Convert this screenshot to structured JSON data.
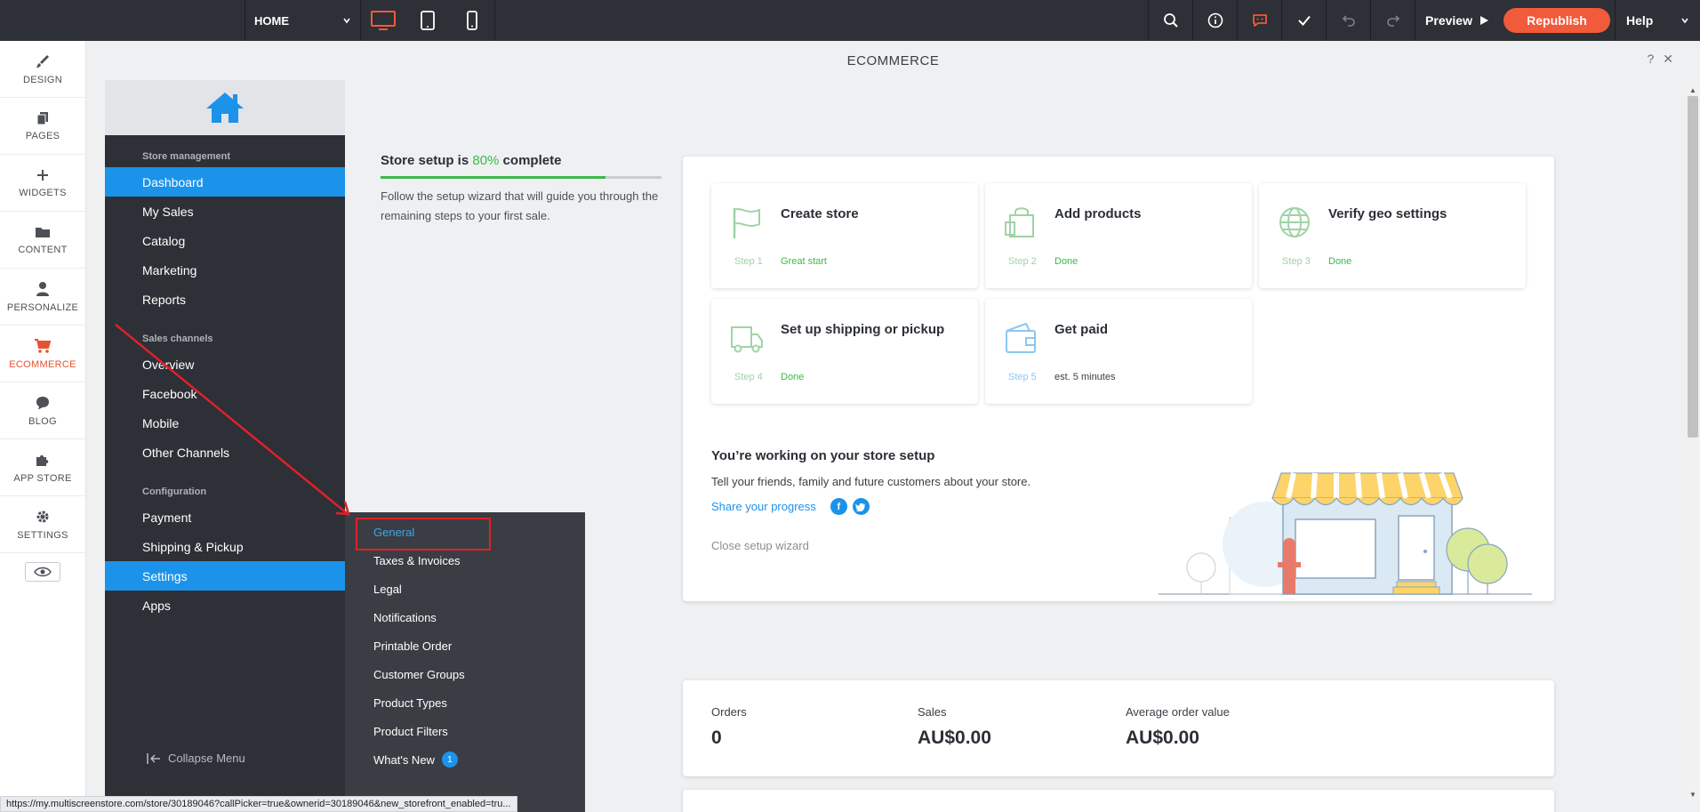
{
  "topbar": {
    "page_select": "HOME",
    "preview_label": "Preview",
    "republish_label": "Republish",
    "help_label": "Help",
    "accent": "#f15a3a"
  },
  "rail": {
    "items": [
      {
        "label": "DESIGN",
        "icon": "brush-icon"
      },
      {
        "label": "PAGES",
        "icon": "pages-icon"
      },
      {
        "label": "WIDGETS",
        "icon": "plus-icon"
      },
      {
        "label": "CONTENT",
        "icon": "folder-icon"
      },
      {
        "label": "PERSONALIZE",
        "icon": "person-icon"
      },
      {
        "label": "ECOMMERCE",
        "icon": "cart-icon"
      },
      {
        "label": "BLOG",
        "icon": "chat-bubble-icon"
      },
      {
        "label": "APP STORE",
        "icon": "puzzle-icon"
      },
      {
        "label": "SETTINGS",
        "icon": "gear-icon"
      }
    ]
  },
  "frame": {
    "title": "ECOMMERCE",
    "help_mark": "?",
    "close_mark": "✕"
  },
  "sidebar": {
    "store_management": "Store management",
    "dashboard": "Dashboard",
    "my_sales": "My Sales",
    "catalog": "Catalog",
    "marketing": "Marketing",
    "reports": "Reports",
    "sales_channels": "Sales channels",
    "overview": "Overview",
    "facebook": "Facebook",
    "mobile": "Mobile",
    "other_channels": "Other Channels",
    "configuration": "Configuration",
    "payment": "Payment",
    "shipping": "Shipping & Pickup",
    "settings": "Settings",
    "apps": "Apps",
    "collapse": "Collapse Menu"
  },
  "submenu": {
    "items": [
      "General",
      "Taxes & Invoices",
      "Legal",
      "Notifications",
      "Printable Order",
      "Customer Groups",
      "Product Types",
      "Product Filters",
      "What's New"
    ],
    "whats_new_badge": "1"
  },
  "progress": {
    "title_before": "Store setup is ",
    "percent_text": "80%",
    "title_after": " complete",
    "percent": 80,
    "desc": "Follow the setup wizard that will guide you through the remaining steps to your first sale."
  },
  "steps": [
    {
      "title": "Create store",
      "num": "Step 1",
      "status": "Great start"
    },
    {
      "title": "Add products",
      "num": "Step 2",
      "status": "Done"
    },
    {
      "title": "Verify geo settings",
      "num": "Step 3",
      "status": "Done"
    },
    {
      "title": "Set up shipping or pickup",
      "num": "Step 4",
      "status": "Done"
    },
    {
      "title": "Get paid",
      "num": "Step 5",
      "status": "est. 5 minutes"
    }
  ],
  "wizard": {
    "heading": "You’re working on your store setup",
    "text": "Tell your friends, family and future customers about your store.",
    "share": "Share your progress",
    "close": "Close setup wizard"
  },
  "stats": {
    "orders_label": "Orders",
    "orders_value": "0",
    "sales_label": "Sales",
    "sales_value": "AU$0.00",
    "avg_label": "Average order value",
    "avg_value": "AU$0.00"
  },
  "status_url": "https://my.multiscreenstore.com/store/30189046?callPicker=true&ownerid=30189046&new_storefront_enabled=tru..."
}
